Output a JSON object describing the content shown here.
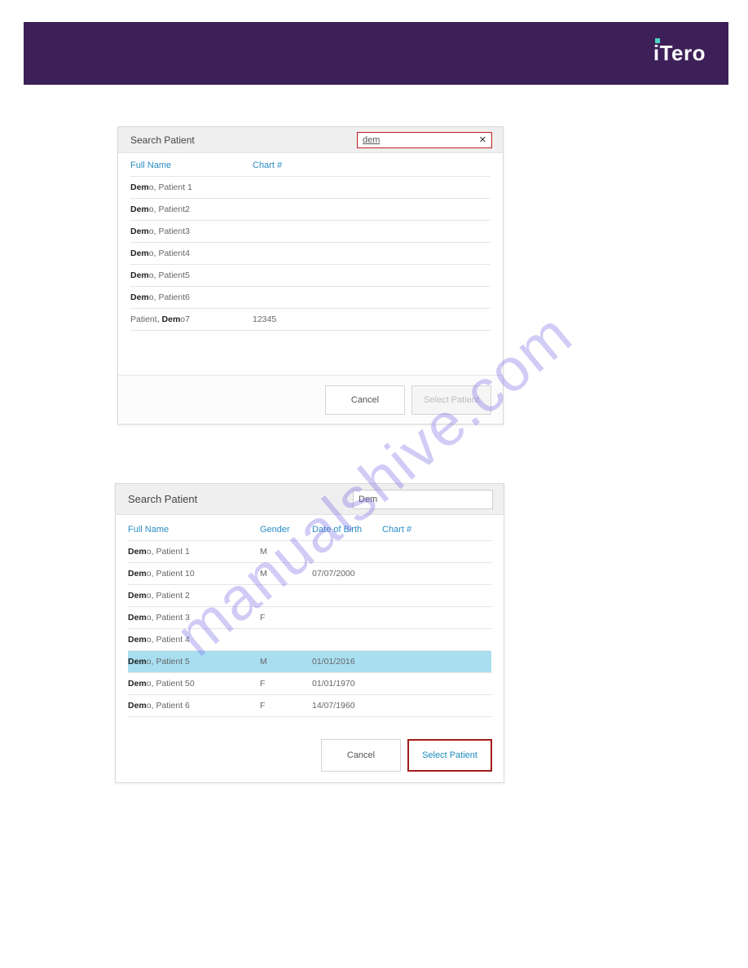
{
  "brand": {
    "logo": "iTero"
  },
  "watermark": "manualshive.com",
  "panel1": {
    "title": "Search Patient",
    "search_value": "dem",
    "headers": {
      "full_name": "Full Name",
      "chart": "Chart #"
    },
    "rows": [
      {
        "bold": "Dem",
        "rest": "o, Patient 1",
        "chart": ""
      },
      {
        "bold": "Dem",
        "rest": "o, Patient2",
        "chart": ""
      },
      {
        "bold": "Dem",
        "rest": "o, Patient3",
        "chart": ""
      },
      {
        "bold": "Dem",
        "rest": "o, Patient4",
        "chart": ""
      },
      {
        "bold": "Dem",
        "rest": "o, Patient5",
        "chart": ""
      },
      {
        "bold": "Dem",
        "rest": "o, Patient6",
        "chart": ""
      },
      {
        "prefix": "Patient, ",
        "bold": "Dem",
        "rest": "o7",
        "chart": "12345"
      }
    ],
    "buttons": {
      "cancel": "Cancel",
      "select": "Select Patient"
    }
  },
  "panel2": {
    "title": "Search Patient",
    "search_value": "Dem",
    "headers": {
      "full_name": "Full Name",
      "gender": "Gender",
      "dob": "Date of Birth",
      "chart": "Chart #"
    },
    "rows": [
      {
        "bold": "Dem",
        "rest": "o, Patient 1",
        "gender": "M",
        "dob": "",
        "chart": ""
      },
      {
        "bold": "Dem",
        "rest": "o, Patient 10",
        "gender": "M",
        "dob": "07/07/2000",
        "chart": ""
      },
      {
        "bold": "Dem",
        "rest": "o, Patient 2",
        "gender": "",
        "dob": "",
        "chart": ""
      },
      {
        "bold": "Dem",
        "rest": "o, Patient 3",
        "gender": "F",
        "dob": "",
        "chart": ""
      },
      {
        "bold": "Dem",
        "rest": "o, Patient 4",
        "gender": "",
        "dob": "",
        "chart": ""
      },
      {
        "bold": "Dem",
        "rest": "o, Patient 5",
        "gender": "M",
        "dob": "01/01/2016",
        "chart": "",
        "selected": true
      },
      {
        "bold": "Dem",
        "rest": "o, Patient 50",
        "gender": "F",
        "dob": "01/01/1970",
        "chart": ""
      },
      {
        "bold": "Dem",
        "rest": "o, Patient 6",
        "gender": "F",
        "dob": "14/07/1960",
        "chart": ""
      }
    ],
    "buttons": {
      "cancel": "Cancel",
      "select": "Select Patient"
    }
  }
}
